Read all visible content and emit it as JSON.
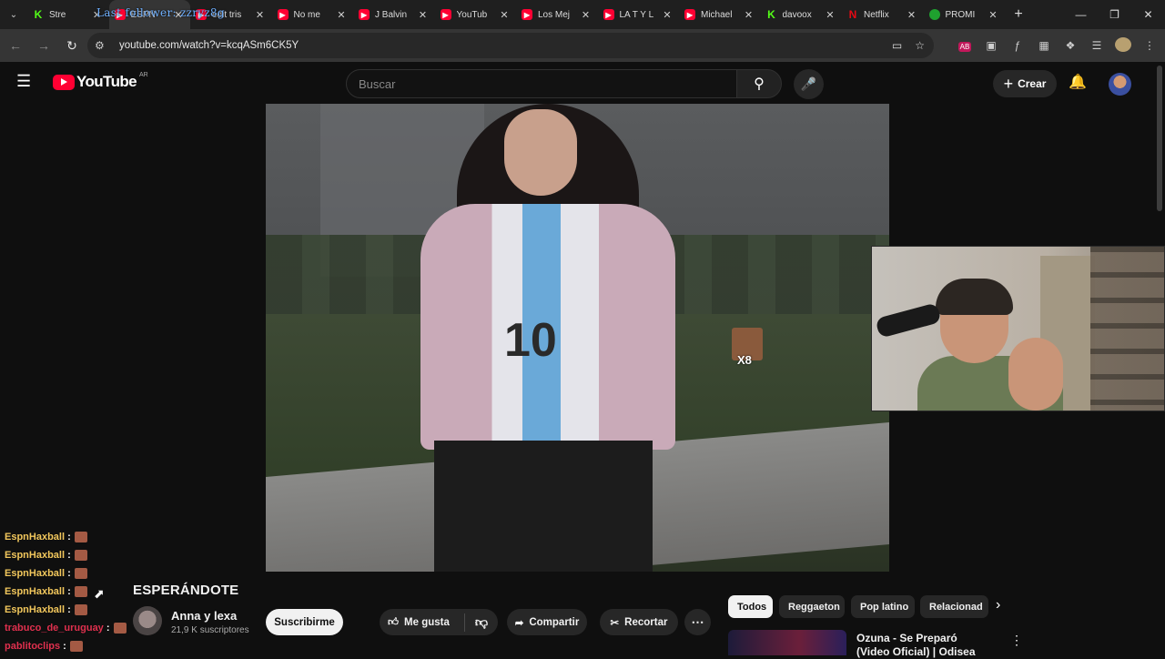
{
  "browser": {
    "tabs": [
      {
        "label": "Stre",
        "favicon": "kick"
      },
      {
        "label": "ESPN",
        "favicon": "yt",
        "active": true
      },
      {
        "label": "edit tris",
        "favicon": "yt"
      },
      {
        "label": "No me",
        "favicon": "yt"
      },
      {
        "label": "J Balvin",
        "favicon": "yt"
      },
      {
        "label": "YouTub",
        "favicon": "yt"
      },
      {
        "label": "Los Mej",
        "favicon": "yt"
      },
      {
        "label": "LA T Y L",
        "favicon": "yt"
      },
      {
        "label": "Michael",
        "favicon": "yt"
      },
      {
        "label": "davoox",
        "favicon": "kick"
      },
      {
        "label": "Netflix",
        "favicon": "netflix"
      },
      {
        "label": "PROMI",
        "favicon": "green"
      }
    ],
    "overlay_text": "Last follower: zzryz8g",
    "url": "youtube.com/watch?v=kcqASm6CK5Y",
    "extension_badge": "AB"
  },
  "youtube": {
    "logo_text": "YouTube",
    "country_code": "AR",
    "search_placeholder": "Buscar",
    "create_label": "Crear"
  },
  "video": {
    "jersey_number": "10",
    "badge_count": "X8"
  },
  "stream_chat": [
    {
      "user": "EspnHaxball",
      "color": "#f2c75c"
    },
    {
      "user": "EspnHaxball",
      "color": "#f2c75c"
    },
    {
      "user": "EspnHaxball",
      "color": "#f2c75c"
    },
    {
      "user": "EspnHaxball",
      "color": "#f2c75c"
    },
    {
      "user": "EspnHaxball",
      "color": "#f2c75c"
    },
    {
      "user": "trabuco_de_uruguay",
      "color": "#e0304e"
    },
    {
      "user": "pablitoclips",
      "color": "#e0304e"
    }
  ],
  "watch": {
    "title": "ESPERÁNDOTE",
    "channel_name": "Anna y lexa",
    "subscribers": "21,9 K suscriptores",
    "subscribe_label": "Suscribirme",
    "like_label": "Me gusta",
    "share_label": "Compartir",
    "clip_label": "Recortar"
  },
  "chips": [
    "Todos",
    "Reggaeton",
    "Pop latino",
    "Relacionad"
  ],
  "recommendation": {
    "title": "Ozuna - Se Preparó (Video Oficial) | Odisea"
  }
}
